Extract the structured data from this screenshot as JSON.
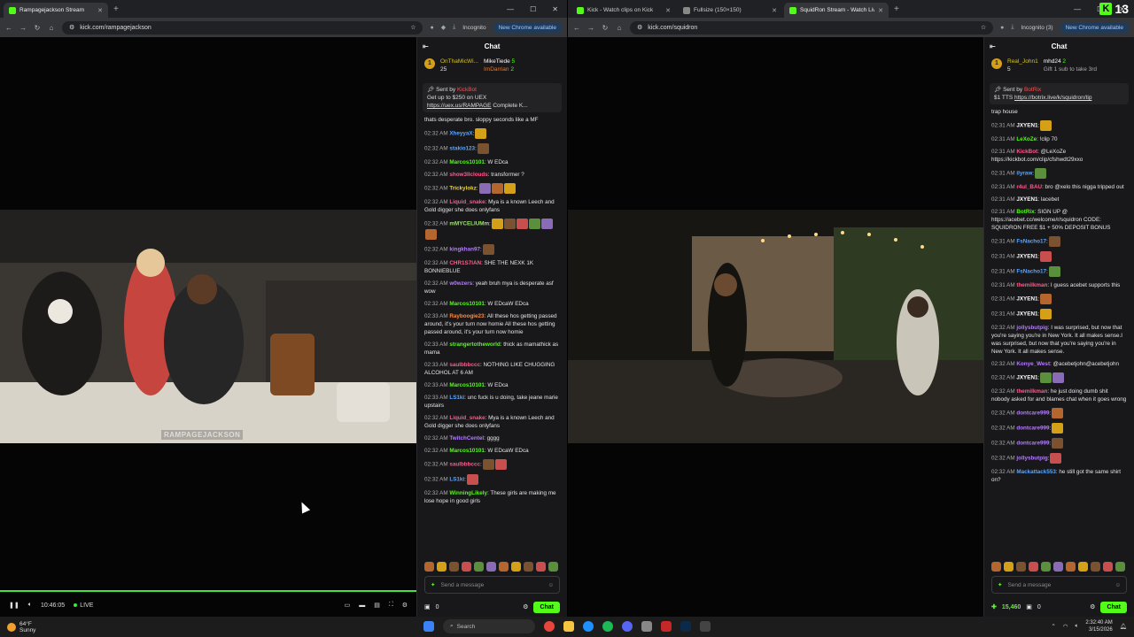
{
  "left": {
    "tabs": [
      {
        "title": "Rampagejackson Stream",
        "active": true,
        "color": "#53fc18"
      }
    ],
    "url": "kick.com/rampagejackson",
    "incognito": "Incognito",
    "new_chrome": "New Chrome available",
    "watermark": "RAMPAGEJACKSON",
    "time": "10:46:05",
    "live": "LIVE",
    "chat_title": "Chat",
    "pinned": {
      "u1": "OnThaMicWi...",
      "u1_count": "25",
      "u2": "MikeTiede",
      "u2_count": "5",
      "u3": "ImDarrian",
      "u3_count": "2"
    },
    "sent_by": "Sent by",
    "sent_name": "KickBot",
    "sent_text": "Get up to $250 on UEX",
    "sent_link": "https://uex.us/RAMPAGE",
    "sent_tail": "Complete K...",
    "messages": [
      {
        "t": "",
        "u": "",
        "c": "#ccc",
        "m": "thats desperate bro. sloppy seconds like a MF"
      },
      {
        "t": "02:32 AM",
        "u": "XheyyaX",
        "c": "#5aa6ff",
        "m": ":",
        "e": 1
      },
      {
        "t": "02:32 AM",
        "u": "stakio123",
        "c": "#5aa6ff",
        "m": ":",
        "e": 1
      },
      {
        "t": "02:32 AM",
        "u": "Marcos10101",
        "c": "#53fc18",
        "m": ": W EDca"
      },
      {
        "t": "02:32 AM",
        "u": "show3llclouds",
        "c": "#ff5a8a",
        "m": ": transformer ?"
      },
      {
        "t": "02:32 AM",
        "u": "Trickylokz",
        "c": "#e8d23a",
        "m": ":",
        "e": 3
      },
      {
        "t": "02:32 AM",
        "u": "Liquid_snake",
        "c": "#ff5a8a",
        "m": ": Mya is a known Leech and Gold digger she does onlyfans"
      },
      {
        "t": "02:32 AM",
        "u": "mMYCELIUMm",
        "c": "#9be564",
        "m": ":",
        "e": 6
      },
      {
        "t": "02:32 AM",
        "u": "kingkhan97",
        "c": "#b57bff",
        "m": ":",
        "e": 1
      },
      {
        "t": "02:32 AM",
        "u": "CHR1S7IAN",
        "c": "#ff5a8a",
        "m": ": SHE THE NEXK 1K BONNIEBLUE"
      },
      {
        "t": "02:32 AM",
        "u": "w0wzers",
        "c": "#b57bff",
        "m": ": yeah bruh mya is desperate asf wow"
      },
      {
        "t": "02:32 AM",
        "u": "Marcos10101",
        "c": "#53fc18",
        "m": ": W EDcaW EDca"
      },
      {
        "t": "02:33 AM",
        "u": "Rayboogie23",
        "c": "#ff8a3d",
        "m": ": All these hos getting passed around, it's your turn now homie All these hos getting passed around, it's your turn now homie"
      },
      {
        "t": "02:33 AM",
        "u": "strangertotheworld",
        "c": "#53fc18",
        "m": ": thick as mamathick as mama"
      },
      {
        "t": "02:33 AM",
        "u": "saulbbbccc",
        "c": "#ff5a8a",
        "m": ": NOTHING LIKE CHUGGING ALCOHOL AT 6 AM"
      },
      {
        "t": "02:33 AM",
        "u": "Marcos10101",
        "c": "#53fc18",
        "m": ": W EDca"
      },
      {
        "t": "02:33 AM",
        "u": "LS1ki",
        "c": "#5aa6ff",
        "m": ": unc fuck is u doing, take jeane marie upstairs"
      },
      {
        "t": "02:32 AM",
        "u": "Liquid_snake",
        "c": "#ff5a8a",
        "m": ": Mya is a known Leech and Gold digger she does onlyfans"
      },
      {
        "t": "02:32 AM",
        "u": "TwitchCentel",
        "c": "#b57bff",
        "m": ": gggg"
      },
      {
        "t": "02:32 AM",
        "u": "Marcos10101",
        "c": "#53fc18",
        "m": ": W EDcaW EDca"
      },
      {
        "t": "02:32 AM",
        "u": "saulbbbccc",
        "c": "#ff5a8a",
        "m": ":",
        "e": 2
      },
      {
        "t": "02:32 AM",
        "u": "LS1ki",
        "c": "#5aa6ff",
        "m": ":",
        "e": 1
      },
      {
        "t": "02:32 AM",
        "u": "WinningLikely",
        "c": "#53fc18",
        "m": ": These girls are making me lose hope in good girls"
      }
    ],
    "placeholder": "Send a message",
    "count": "0",
    "chat_btn": "Chat"
  },
  "right": {
    "tabs": [
      {
        "title": "Kick - Watch clips on Kick",
        "active": false,
        "color": "#53fc18"
      },
      {
        "title": "Fullsize (150×150)",
        "active": false,
        "color": "#888888"
      },
      {
        "title": "SquidRon Stream - Watch Live",
        "active": true,
        "color": "#53fc18"
      }
    ],
    "url": "kick.com/squidron",
    "incognito": "Incognito (3)",
    "new_chrome": "New Chrome available",
    "chat_title": "Chat",
    "pinned": {
      "u1": "Real_John1",
      "u1_count": "5",
      "u2": "mhd24",
      "u2_count": "2",
      "u3": "Gift 1 sub to take 3rd"
    },
    "sent_by": "Sent by",
    "sent_name": "BotRix",
    "sent_text": "$1 TTS",
    "sent_link": "https://botrix.live/k/squidron/tip",
    "messages": [
      {
        "t": "",
        "u": "",
        "c": "#ccc",
        "m": "trap house"
      },
      {
        "t": "02:31 AM",
        "u": "JXYEN1",
        "c": "#fff",
        "m": ":",
        "e": 1
      },
      {
        "t": "02:31 AM",
        "u": "LeXoZe",
        "c": "#53fc18",
        "m": ": !clip 70"
      },
      {
        "t": "02:31 AM",
        "u": "KickBot",
        "c": "#ff5a8a",
        "m": ": @LeXoZe https://kickbot.com/clip/cfshwdt29xxo"
      },
      {
        "t": "02:31 AM",
        "u": "ilyraw",
        "c": "#5aa6ff",
        "m": ":",
        "e": 1
      },
      {
        "t": "02:31 AM",
        "u": "r4ul_BAU",
        "c": "#ff5a8a",
        "m": ": bro @xelo this nigga tripped out"
      },
      {
        "t": "02:31 AM",
        "u": "JXYEN1",
        "c": "#fff",
        "m": ": lacebet"
      },
      {
        "t": "02:31 AM",
        "u": "BotRix",
        "c": "#53fc18",
        "m": ": SIGN UP @ https://acebet.cc/welcome/r/squidron CODE: SQUIDRON FREE $1 + 50% DEPOSIT BONUS"
      },
      {
        "t": "02:31 AM",
        "u": "FsNacho17",
        "c": "#5aa6ff",
        "m": ":",
        "e": 1
      },
      {
        "t": "02:31 AM",
        "u": "JXYEN1",
        "c": "#fff",
        "m": ":",
        "e": 1
      },
      {
        "t": "02:31 AM",
        "u": "FsNacho17",
        "c": "#5aa6ff",
        "m": ":",
        "e": 1
      },
      {
        "t": "02:31 AM",
        "u": "themilkman",
        "c": "#ff5a8a",
        "m": ": I guess acebet supports this"
      },
      {
        "t": "02:31 AM",
        "u": "JXYEN1",
        "c": "#fff",
        "m": ":",
        "e": 1
      },
      {
        "t": "02:31 AM",
        "u": "JXYEN1",
        "c": "#fff",
        "m": ":",
        "e": 1
      },
      {
        "t": "02:32 AM",
        "u": "jollysbutpig",
        "c": "#b57bff",
        "m": ": I was surprised, but now that you're saying you're in New York. It all makes sense.I was surprised, but now that you're saying you're in New York. It all makes sense."
      },
      {
        "t": "02:32 AM",
        "u": "Konye_West",
        "c": "#b57bff",
        "m": ": @acebetjohn@acebetjohn"
      },
      {
        "t": "02:32 AM",
        "u": "JXYEN1",
        "c": "#fff",
        "m": ":",
        "e": 2
      },
      {
        "t": "02:32 AM",
        "u": "themilkman",
        "c": "#ff5a8a",
        "m": ": he just doing dumb shit nobody asked for and blames chat when it goes wrong"
      },
      {
        "t": "02:32 AM",
        "u": "dontcare999",
        "c": "#b57bff",
        "m": ":",
        "e": 1
      },
      {
        "t": "02:32 AM",
        "u": "dontcare999",
        "c": "#b57bff",
        "m": ":",
        "e": 1
      },
      {
        "t": "02:32 AM",
        "u": "dontcare999",
        "c": "#b57bff",
        "m": ":",
        "e": 1
      },
      {
        "t": "02:32 AM",
        "u": "jollysbutpig",
        "c": "#b57bff",
        "m": ":",
        "e": 1
      },
      {
        "t": "02:32 AM",
        "u": "Mackattack553",
        "c": "#5aa6ff",
        "m": ": he still got the same shirt on?"
      }
    ],
    "placeholder": "Send a message",
    "kicks": "15,460",
    "count": "0",
    "chat_btn": "Chat"
  },
  "overlay": {
    "number": "13"
  },
  "taskbar": {
    "temp": "64°F",
    "weather": "Sunny",
    "search": "Search",
    "time": "2:32:40 AM",
    "date": "3/15/2026"
  }
}
